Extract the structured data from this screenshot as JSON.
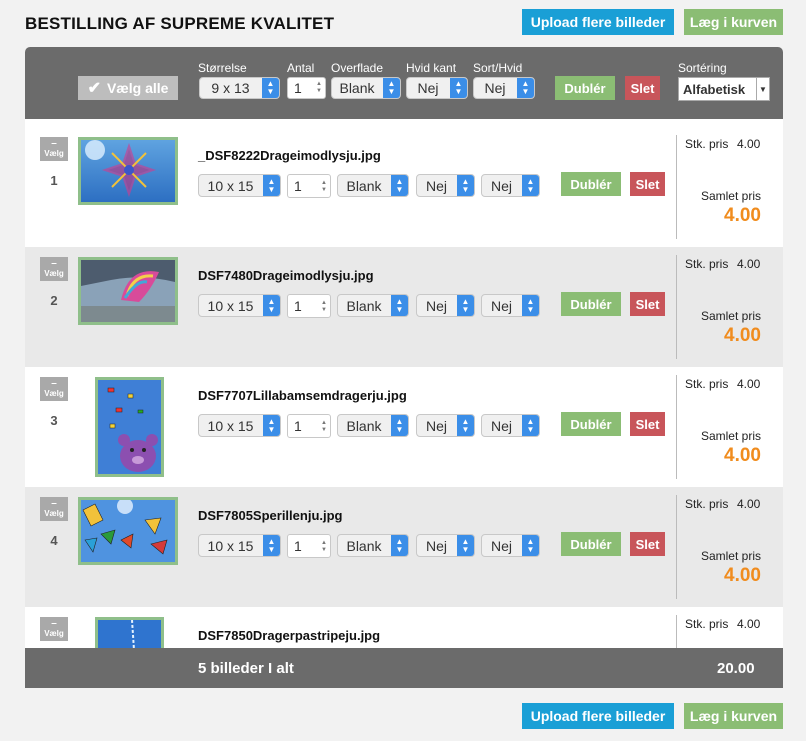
{
  "title": "BESTILLING AF SUPREME KVALITET",
  "buttons": {
    "upload": "Upload flere billeder",
    "cart": "Læg i kurven"
  },
  "toolbar": {
    "select_all": "Vælg alle",
    "labels": {
      "size": "Størrelse",
      "qty": "Antal",
      "surface": "Overflade",
      "border": "Hvid kant",
      "bw": "Sort/Hvid",
      "sort": "Sortéring"
    },
    "size": "9 x 13",
    "qty": "1",
    "surface": "Blank",
    "border": "Nej",
    "bw": "Nej",
    "dub": "Dublér",
    "del": "Slet",
    "sort": "Alfabetisk"
  },
  "row_labels": {
    "select": "Vælg",
    "dub": "Dublér",
    "del": "Slet",
    "unit_price": "Stk. pris",
    "total_price": "Samlet pris"
  },
  "rows": [
    {
      "index": "1",
      "filename": "_DSF8222Drageimodlysju.jpg",
      "size": "10 x 15",
      "qty": "1",
      "surface": "Blank",
      "border": "Nej",
      "bw": "Nej",
      "unit_price": "4.00",
      "total": "4.00"
    },
    {
      "index": "2",
      "filename": "DSF7480Drageimodlysju.jpg",
      "size": "10 x 15",
      "qty": "1",
      "surface": "Blank",
      "border": "Nej",
      "bw": "Nej",
      "unit_price": "4.00",
      "total": "4.00"
    },
    {
      "index": "3",
      "filename": "DSF7707Lillabamsemdragerju.jpg",
      "size": "10 x 15",
      "qty": "1",
      "surface": "Blank",
      "border": "Nej",
      "bw": "Nej",
      "unit_price": "4.00",
      "total": "4.00"
    },
    {
      "index": "4",
      "filename": "DSF7805Sperillenju.jpg",
      "size": "10 x 15",
      "qty": "1",
      "surface": "Blank",
      "border": "Nej",
      "bw": "Nej",
      "unit_price": "4.00",
      "total": "4.00"
    },
    {
      "filename": "DSF7850Dragerpastripeju.jpg",
      "unit_price": "4.00"
    }
  ],
  "footer": {
    "count": "5 billeder I alt",
    "total": "20.00"
  },
  "colors": {
    "accent_blue": "#1a9fd6",
    "green": "#8bbd74",
    "red": "#c8555a",
    "orange": "#f08c1e",
    "toolbar_gray": "#6b6b6b"
  }
}
